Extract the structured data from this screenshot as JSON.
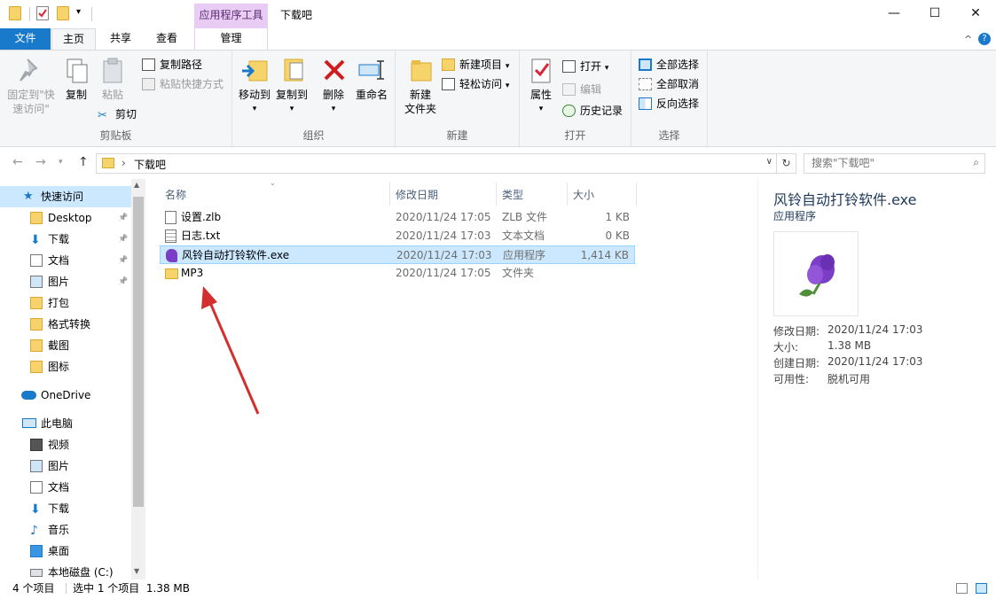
{
  "titlebar": {
    "context_tab_title": "应用程序工具",
    "window_title": "下载吧"
  },
  "tabs": {
    "file": "文件",
    "home": "主页",
    "share": "共享",
    "view": "查看",
    "manage": "管理"
  },
  "ribbon": {
    "clipboard": {
      "label": "剪贴板",
      "pin": "固定到\"快速访问\"",
      "pin_line1": "固定到\"快",
      "pin_line2": "速访问\"",
      "copy": "复制",
      "paste": "粘贴",
      "copy_path": "复制路径",
      "paste_shortcut": "粘贴快捷方式",
      "cut": "剪切"
    },
    "organize": {
      "label": "组织",
      "move_to": "移动到",
      "copy_to": "复制到",
      "delete": "删除",
      "rename": "重命名"
    },
    "new": {
      "label": "新建",
      "new_folder_line1": "新建",
      "new_folder_line2": "文件夹",
      "new_item": "新建项目",
      "easy_access": "轻松访问"
    },
    "open": {
      "label": "打开",
      "properties": "属性",
      "open": "打开",
      "edit": "编辑",
      "history": "历史记录"
    },
    "select": {
      "label": "选择",
      "select_all": "全部选择",
      "select_none": "全部取消",
      "invert": "反向选择"
    }
  },
  "address": {
    "path": "下载吧",
    "search_placeholder": "搜索\"下载吧\""
  },
  "nav": {
    "quick_access": "快速访问",
    "items": [
      {
        "label": "Desktop",
        "pinned": true
      },
      {
        "label": "下载",
        "pinned": true
      },
      {
        "label": "文档",
        "pinned": true
      },
      {
        "label": "图片",
        "pinned": true
      },
      {
        "label": "打包",
        "pinned": false
      },
      {
        "label": "格式转换",
        "pinned": false
      },
      {
        "label": "截图",
        "pinned": false
      },
      {
        "label": "图标",
        "pinned": false
      }
    ],
    "onedrive": "OneDrive",
    "this_pc": "此电脑",
    "pc_items": [
      "视频",
      "图片",
      "文档",
      "下载",
      "音乐",
      "桌面",
      "本地磁盘 (C:)"
    ]
  },
  "columns": {
    "name": "名称",
    "date": "修改日期",
    "type": "类型",
    "size": "大小"
  },
  "files": [
    {
      "name": "设置.zlb",
      "date": "2020/11/24 17:05",
      "type": "ZLB 文件",
      "size": "1 KB",
      "icon": "document-icon"
    },
    {
      "name": "日志.txt",
      "date": "2020/11/24 17:03",
      "type": "文本文档",
      "size": "0 KB",
      "icon": "text-file-icon"
    },
    {
      "name": "风铃自动打铃软件.exe",
      "date": "2020/11/24 17:03",
      "type": "应用程序",
      "size": "1,414 KB",
      "icon": "app-icon",
      "selected": true
    },
    {
      "name": "MP3",
      "date": "2020/11/24 17:05",
      "type": "文件夹",
      "size": "",
      "icon": "folder-icon"
    }
  ],
  "preview": {
    "name": "风铃自动打铃软件.exe",
    "kind": "应用程序",
    "modified_label": "修改日期:",
    "modified": "2020/11/24 17:03",
    "size_label": "大小:",
    "size": "1.38 MB",
    "created_label": "创建日期:",
    "created": "2020/11/24 17:03",
    "availability_label": "可用性:",
    "availability": "脱机可用"
  },
  "status": {
    "count": "4 个项目",
    "selection": "选中 1 个项目  1.38 MB"
  },
  "colors": {
    "accent": "#1979ca",
    "context_tab": "#e9ccf3",
    "selection": "#cce8ff",
    "annotation_arrow": "#d32f2f"
  }
}
